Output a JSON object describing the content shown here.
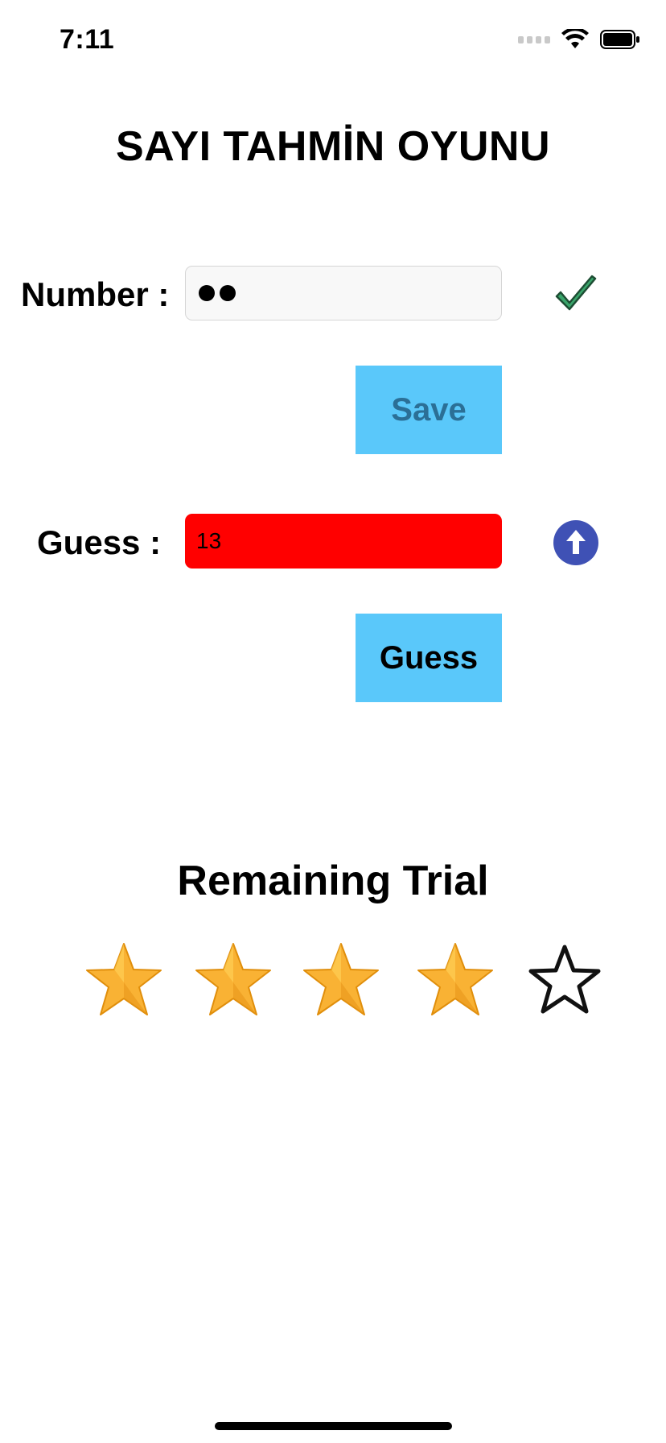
{
  "status_bar": {
    "time": "7:11"
  },
  "title": "SAYI TAHMİN OYUNU",
  "number_section": {
    "label": "Number :",
    "masked_value_dots": 2,
    "status_icon": "checkmark-icon"
  },
  "save_button": {
    "label": "Save"
  },
  "guess_section": {
    "label": "Guess :",
    "value": "13",
    "field_color": "#ff0000",
    "hint_icon": "arrow-up-icon"
  },
  "guess_button": {
    "label": "Guess"
  },
  "remaining": {
    "title": "Remaining Trial",
    "filled_stars": 4,
    "total_stars": 5
  },
  "colors": {
    "button_bg": "#5ac8fa",
    "check_green": "#3aa56b",
    "arrow_circle": "#3f51b5",
    "star_gold": "#f9b234"
  }
}
